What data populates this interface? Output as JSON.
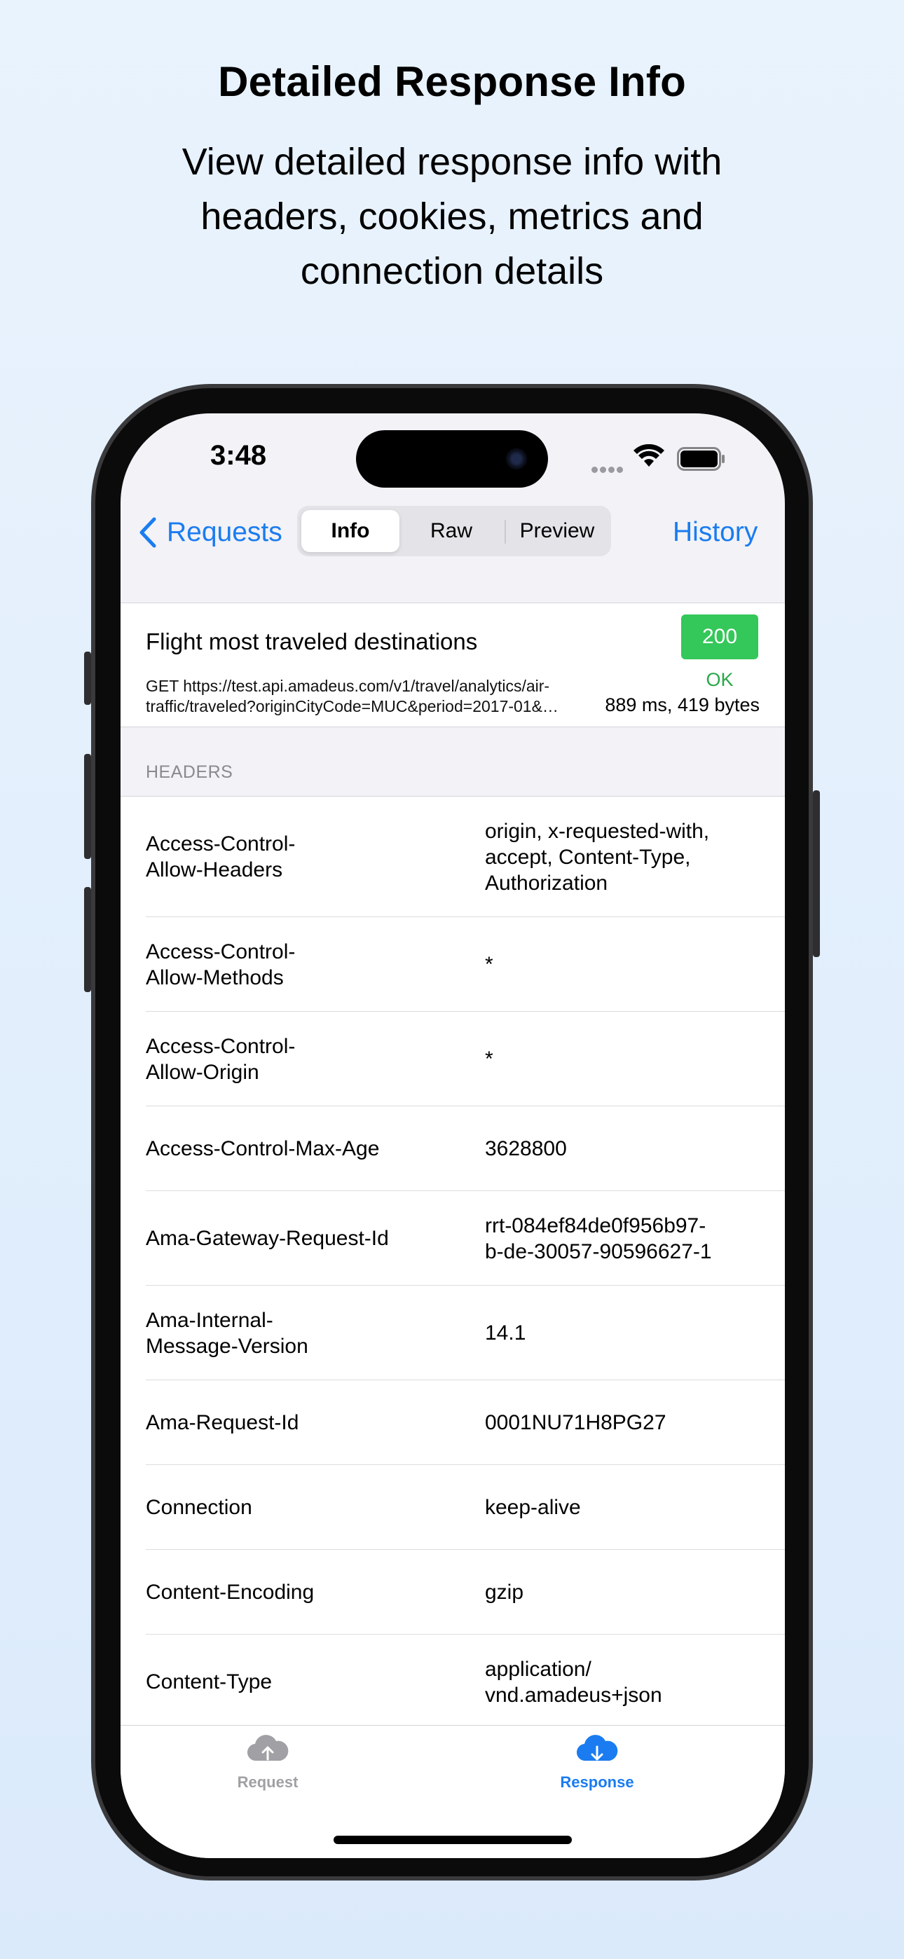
{
  "promo": {
    "title": "Detailed Response Info",
    "subtitle": "View detailed response info with headers, cookies, metrics and connection details"
  },
  "status_bar": {
    "time": "3:48"
  },
  "nav": {
    "back_label": "Requests",
    "segments": [
      "Info",
      "Raw",
      "Preview"
    ],
    "active_segment": "Info",
    "history_label": "History"
  },
  "summary": {
    "title": "Flight most traveled destinations",
    "url": "GET https://test.api.amadeus.com/v1/travel/analytics/air-traffic/traveled?originCityCode=MUC&period=2017-01&…",
    "status_code": "200",
    "status_text": "OK",
    "metrics": "889 ms, 419 bytes",
    "status_color": "#34c759"
  },
  "headers_section": {
    "label": "HEADERS",
    "rows": [
      {
        "key": "Access-Control-\nAllow-Headers",
        "value": "origin, x-requested-with,\naccept, Content-Type,\nAuthorization"
      },
      {
        "key": "Access-Control-\nAllow-Methods",
        "value": "*"
      },
      {
        "key": "Access-Control-\nAllow-Origin",
        "value": "*"
      },
      {
        "key": "Access-Control-Max-Age",
        "value": "3628800"
      },
      {
        "key": "Ama-Gateway-Request-Id",
        "value": "rrt-084ef84de0f956b97-\nb-de-30057-90596627-1"
      },
      {
        "key": "Ama-Internal-\nMessage-Version",
        "value": "14.1"
      },
      {
        "key": "Ama-Request-Id",
        "value": "0001NU71H8PG27"
      },
      {
        "key": "Connection",
        "value": "keep-alive"
      },
      {
        "key": "Content-Encoding",
        "value": "gzip"
      },
      {
        "key": "Content-Type",
        "value": "application/\nvnd.amadeus+json"
      }
    ]
  },
  "tabbar": {
    "items": [
      {
        "label": "Request",
        "icon": "cloud-upload-icon",
        "active": false
      },
      {
        "label": "Response",
        "icon": "cloud-download-icon",
        "active": true
      }
    ],
    "accent_color": "#1a7cf0",
    "inactive_color": "#a0a0a5"
  }
}
